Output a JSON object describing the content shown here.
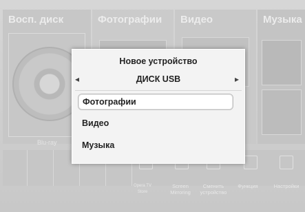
{
  "tiles": {
    "disc": {
      "title": "Восп. диск",
      "sub_label": "Blu-ray"
    },
    "photos": {
      "title": "Фотографии"
    },
    "video": {
      "title": "Видео"
    },
    "music": {
      "title": "Музыка"
    }
  },
  "bottom_bar": {
    "items": [
      {
        "label": "Opera TV Store",
        "icon": "opera-tv-icon"
      },
      {
        "label": "Screen Mirroring",
        "icon": "screen-mirroring-icon"
      },
      {
        "label": "Сменить устройство",
        "icon": "change-device-icon"
      },
      {
        "label": "Функция",
        "icon": "function-icon"
      },
      {
        "label": "Настройки",
        "icon": "settings-icon"
      }
    ]
  },
  "dialog": {
    "title": "Новое устройство",
    "device_name": "ДИСК USB",
    "left_arrow": "◂",
    "right_arrow": "▸",
    "items": [
      "Фотографии",
      "Видео",
      "Музыка"
    ]
  }
}
